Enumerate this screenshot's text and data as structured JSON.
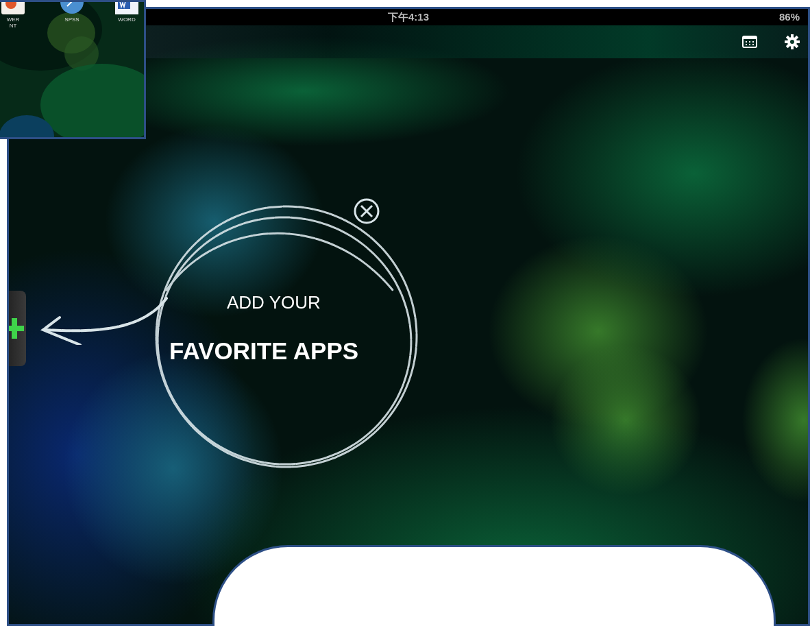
{
  "status_bar": {
    "time": "下午4:13",
    "battery": "86%"
  },
  "toolbar": {
    "buttons": [
      {
        "kind": "calendar"
      },
      {
        "kind": "settings"
      }
    ]
  },
  "prompt": {
    "line_1": "ADD YOUR",
    "line_2": "FAVORITE APPS"
  },
  "inset": {
    "apps": [
      {
        "kind": "presentation",
        "label_lines": [
          "WER",
          "NT"
        ]
      },
      {
        "kind": "statistics",
        "label_lines": [
          "SPSS"
        ]
      },
      {
        "kind": "document",
        "label_lines": [
          "WORD"
        ]
      }
    ]
  }
}
